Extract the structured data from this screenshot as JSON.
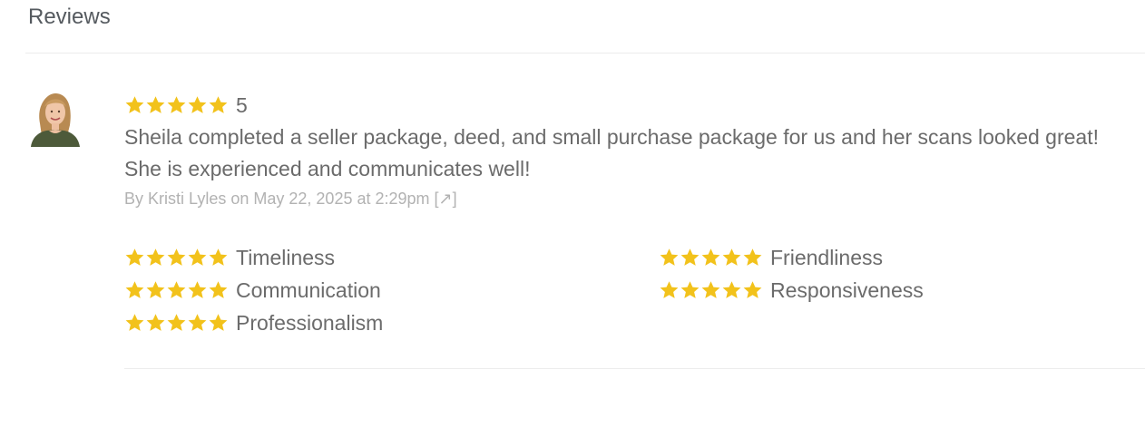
{
  "section": {
    "title": "Reviews"
  },
  "review": {
    "rating": "5",
    "stars_filled": 5,
    "text": "Sheila completed a seller package, deed, and small purchase package for us and her scans looked great! She is experienced and communicates well!",
    "meta_prefix": "By Kristi Lyles on ",
    "date": "May 22, 2025 at 2:29pm",
    "link_glyph": "[↗]"
  },
  "categories": {
    "timeliness": {
      "label": "Timeliness",
      "stars": 5
    },
    "communication": {
      "label": "Communication",
      "stars": 5
    },
    "professionalism": {
      "label": "Professionalism",
      "stars": 5
    },
    "friendliness": {
      "label": "Friendliness",
      "stars": 5
    },
    "responsiveness": {
      "label": "Responsiveness",
      "stars": 5
    }
  },
  "colors": {
    "star": "#f2c21b",
    "text": "#6b6b6b",
    "meta": "#b2b2b2",
    "title": "#555a5f",
    "divider": "#ececec"
  },
  "icons": {
    "star": "star-icon",
    "external_link": "external-link-icon"
  }
}
